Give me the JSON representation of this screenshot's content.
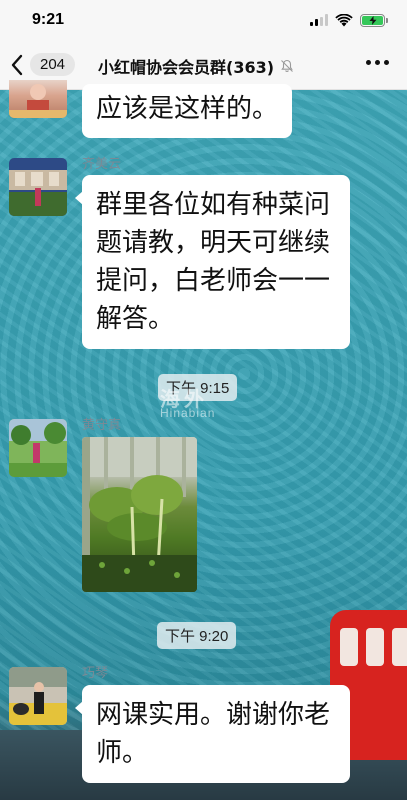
{
  "status_bar": {
    "time": "9:21"
  },
  "nav": {
    "unread_count": "204",
    "title": "小红帽协会会员群(363)"
  },
  "messages": [
    {
      "text": "应该是这样的。"
    },
    {
      "sender": "齐美云",
      "text": "群里各位如有种菜问题请教，明天可继续提问，白老师会一一解答。"
    },
    {
      "timestamp": "下午 9:15"
    },
    {
      "sender": "黄守真",
      "type": "image"
    },
    {
      "timestamp": "下午 9:20"
    },
    {
      "sender": "巧琴",
      "text": "网课实用。谢谢你老师。"
    }
  ],
  "watermark": {
    "text": "海外",
    "subtext": "Hinabian"
  },
  "colors": {
    "chat_background": "#3ba6b8",
    "bubble": "#ffffff",
    "bus_red": "#d7231f"
  }
}
